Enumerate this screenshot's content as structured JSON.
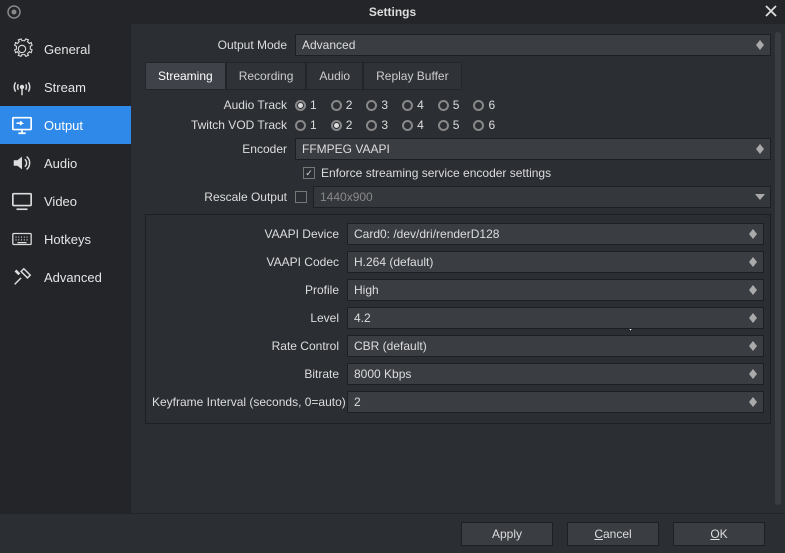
{
  "title": "Settings",
  "sidebar": {
    "items": [
      {
        "label": "General"
      },
      {
        "label": "Stream"
      },
      {
        "label": "Output"
      },
      {
        "label": "Audio"
      },
      {
        "label": "Video"
      },
      {
        "label": "Hotkeys"
      },
      {
        "label": "Advanced"
      }
    ]
  },
  "outputMode": {
    "label": "Output Mode",
    "value": "Advanced"
  },
  "tabs": [
    {
      "label": "Streaming"
    },
    {
      "label": "Recording"
    },
    {
      "label": "Audio"
    },
    {
      "label": "Replay Buffer"
    }
  ],
  "audioTrack": {
    "label": "Audio Track",
    "options": [
      "1",
      "2",
      "3",
      "4",
      "5",
      "6"
    ],
    "selected": "1"
  },
  "vodTrack": {
    "label": "Twitch VOD Track",
    "options": [
      "1",
      "2",
      "3",
      "4",
      "5",
      "6"
    ],
    "selected": "2"
  },
  "encoder": {
    "label": "Encoder",
    "value": "FFMPEG VAAPI"
  },
  "enforce": {
    "label": "Enforce streaming service encoder settings",
    "checked": true
  },
  "rescale": {
    "label": "Rescale Output",
    "value": "1440x900",
    "enabled": false
  },
  "panel": {
    "vaapiDevice": {
      "label": "VAAPI Device",
      "value": "Card0: /dev/dri/renderD128"
    },
    "vaapiCodec": {
      "label": "VAAPI Codec",
      "value": "H.264 (default)"
    },
    "profile": {
      "label": "Profile",
      "value": "High"
    },
    "level": {
      "label": "Level",
      "value": "4.2"
    },
    "rateControl": {
      "label": "Rate Control",
      "value": "CBR (default)"
    },
    "bitrate": {
      "label": "Bitrate",
      "value": "8000 Kbps"
    },
    "keyframe": {
      "label": "Keyframe Interval (seconds, 0=auto)",
      "value": "2"
    }
  },
  "footer": {
    "apply": "Apply",
    "cancel": "Cancel",
    "ok": "OK"
  }
}
